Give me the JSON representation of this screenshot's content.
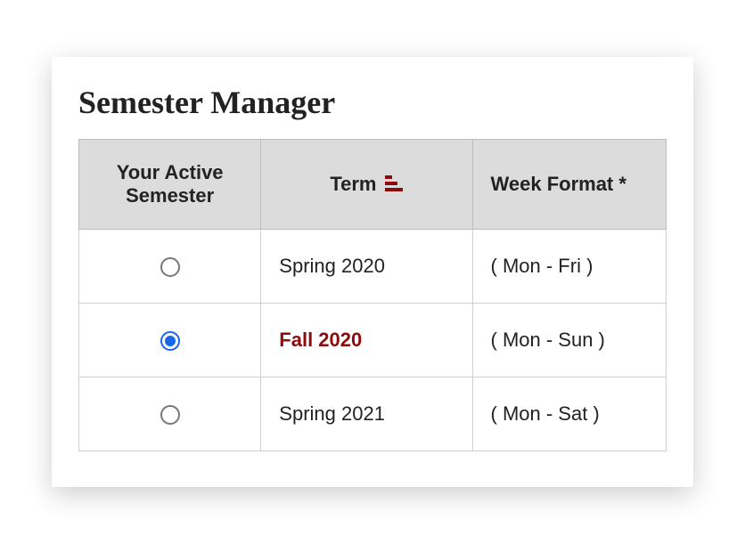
{
  "title": "Semester Manager",
  "columns": {
    "active": "Your Active Semester",
    "term": "Term",
    "week": "Week Format *"
  },
  "rows": [
    {
      "term": "Spring 2020",
      "week": "( Mon - Fri )",
      "selected": false
    },
    {
      "term": "Fall 2020",
      "week": "( Mon - Sun )",
      "selected": true
    },
    {
      "term": "Spring 2021",
      "week": "( Mon - Sat )",
      "selected": false
    }
  ],
  "colors": {
    "accent_red": "#8a0c0c",
    "radio_blue": "#1768e8"
  }
}
